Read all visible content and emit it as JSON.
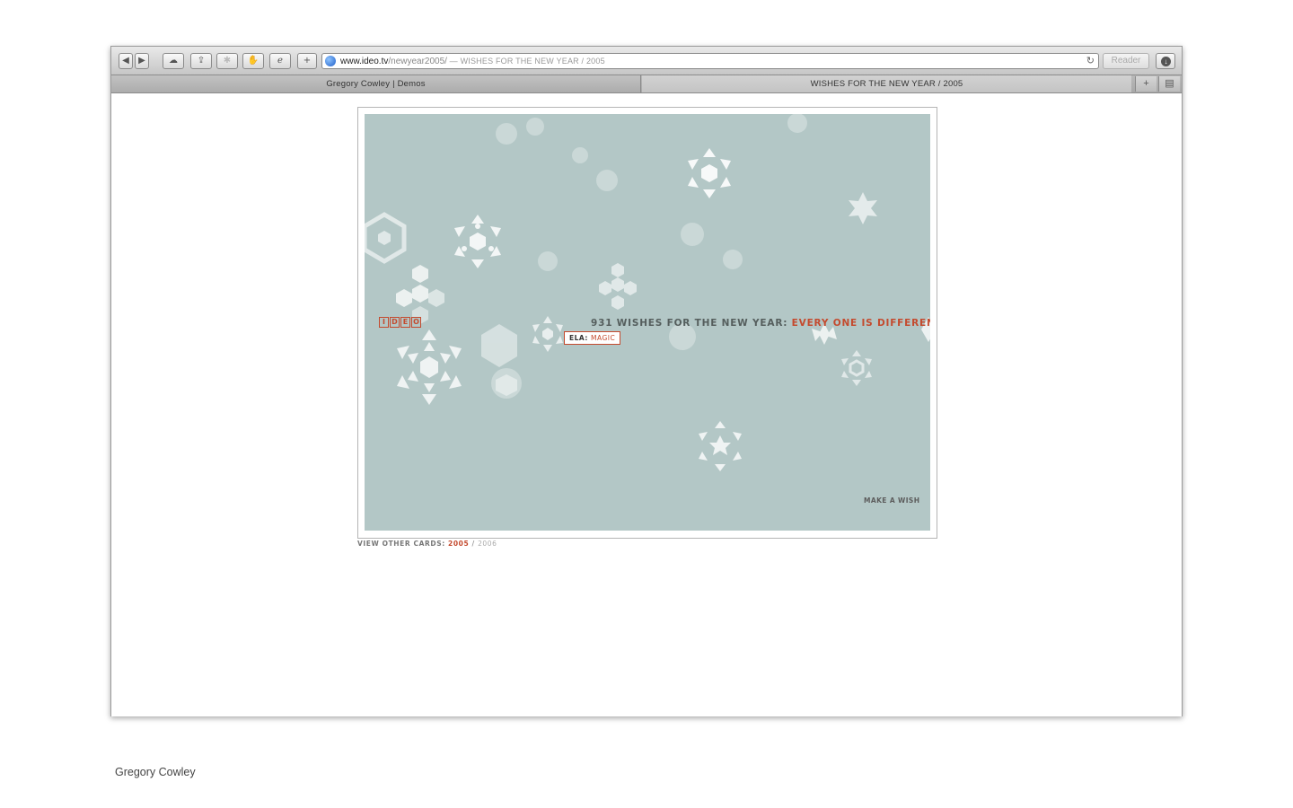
{
  "browser": {
    "address": {
      "host": "www.ideo.tv",
      "path": "/newyear2005/",
      "title_suffix": " — WISHES FOR THE NEW YEAR / 2005"
    },
    "reader_label": "Reader",
    "tabs": [
      {
        "label": "Gregory Cowley | Demos"
      },
      {
        "label": "WISHES FOR THE NEW YEAR / 2005"
      }
    ]
  },
  "card": {
    "logo_letters": [
      "I",
      "D",
      "E",
      "O"
    ],
    "headline_prefix": "931 WISHES FOR THE NEW YEAR: ",
    "headline_highlight": "EVERY ONE IS DIFFERENT",
    "wish_name": "ELA: ",
    "wish_word": "MAGIC",
    "make_wish": "MAKE A WISH",
    "accent_color": "#c44a2e",
    "background_color": "#b3c7c6"
  },
  "other_cards": {
    "label": "VIEW OTHER CARDS: ",
    "current": "2005",
    "separator": " / ",
    "other": "2006"
  },
  "caption": "Gregory Cowley"
}
